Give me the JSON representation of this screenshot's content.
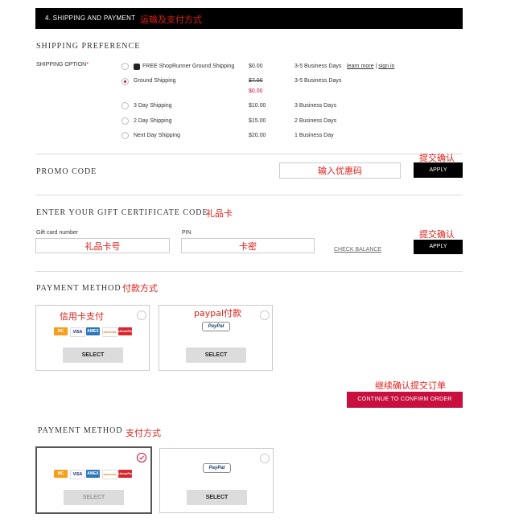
{
  "header": {
    "title": "4. SHIPPING AND PAYMENT",
    "note": "运输及支付方式"
  },
  "shipping": {
    "title": "SHIPPING PREFERENCE",
    "option_label": "SHIPPING OPTION",
    "required_mark": "*",
    "options": [
      {
        "name": "FREE ShopRunner Ground Shipping",
        "price": "$0.00",
        "days": "3-5 Business Days",
        "learn": "learn more",
        "sep": "|",
        "signin": "sign in"
      },
      {
        "name": "Ground Shipping",
        "price_old": "$7.00",
        "price": "$0.00",
        "days": "3-5 Business Days"
      },
      {
        "name": "3 Day Shipping",
        "price": "$10.00",
        "days": "3 Business Days"
      },
      {
        "name": "2 Day Shipping",
        "price": "$15.00",
        "days": "2 Business Days"
      },
      {
        "name": "Next Day Shipping",
        "price": "$20.00",
        "days": "1 Business Day"
      }
    ]
  },
  "promo": {
    "title": "PROMO CODE",
    "input_note": "输入优惠码",
    "apply": "APPLY",
    "apply_note": "提交确认"
  },
  "gift": {
    "title": "ENTER YOUR GIFT CERTIFICATE CODE",
    "title_note": "礼品卡",
    "card_label": "Gift card number",
    "card_note": "礼品卡号",
    "pin_label": "PIN",
    "pin_note": "卡密",
    "check": "CHECK BALANCE",
    "apply": "APPLY",
    "apply_note": "提交确认"
  },
  "payment1": {
    "title": "PAYMENT METHOD",
    "note": "付款方式",
    "credit_note": "信用卡支付",
    "paypal_note": "paypal付款",
    "select": "SELECT",
    "cards": [
      "MC",
      "VISA",
      "AMEX",
      "DISCOVER",
      "UnionPay"
    ],
    "paypal": "PayPal"
  },
  "continue": {
    "note": "继续确认提交订单",
    "label": "CONTINUE TO CONFIRM ORDER"
  },
  "payment2": {
    "title": "PAYMENT METHOD",
    "note": "支付方式",
    "select": "SELECT",
    "paypal": "PayPal"
  },
  "colors": {
    "accent": "#c8103e",
    "annotation": "#e0201a",
    "header_bg": "#000000"
  }
}
